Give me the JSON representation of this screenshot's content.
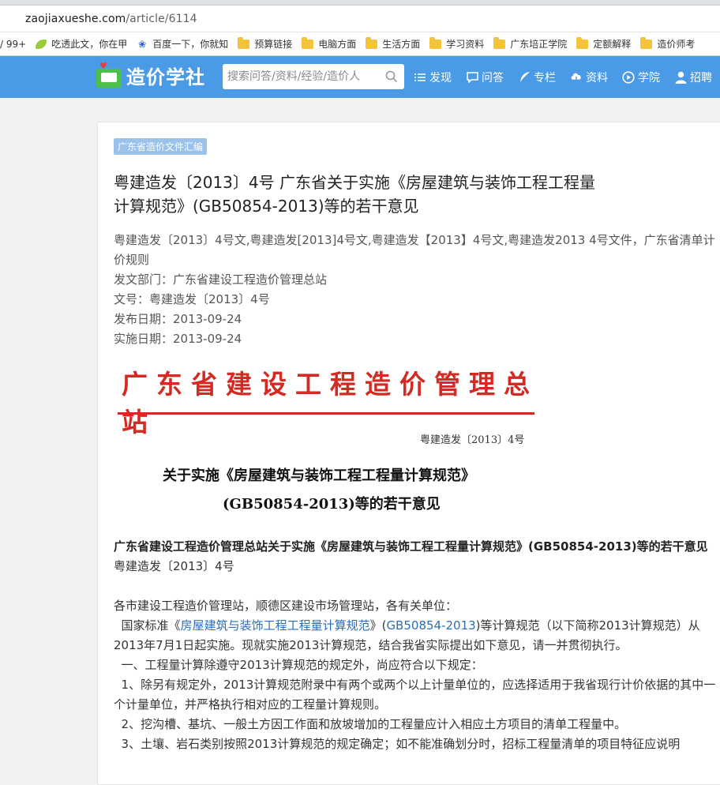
{
  "browser": {
    "url_domain": "zaojiaxueshe.com",
    "url_path": "/article/6114",
    "bookmarks": [
      {
        "label": "/ 99+",
        "icon": "none"
      },
      {
        "label": "吃透此文，你在甲",
        "icon": "leaf-icon"
      },
      {
        "label": "百度一下，你就知",
        "icon": "baidu-paw-icon"
      },
      {
        "label": "预算链接",
        "icon": "folder-icon"
      },
      {
        "label": "电脑方面",
        "icon": "folder-icon"
      },
      {
        "label": "生活方面",
        "icon": "folder-icon"
      },
      {
        "label": "学习资料",
        "icon": "folder-icon"
      },
      {
        "label": "广东培正学院",
        "icon": "folder-icon"
      },
      {
        "label": "定额解释",
        "icon": "folder-icon"
      },
      {
        "label": "造价师考",
        "icon": "folder-icon"
      }
    ]
  },
  "header": {
    "logo_text": "造价学社",
    "search_placeholder": "搜索问答/资料/经验/造价人",
    "nav": [
      {
        "label": "发现",
        "icon": "list-icon"
      },
      {
        "label": "问答",
        "icon": "chat-icon"
      },
      {
        "label": "专栏",
        "icon": "feather-icon"
      },
      {
        "label": "资料",
        "icon": "cloud-download-icon"
      },
      {
        "label": "学院",
        "icon": "play-circle-icon"
      },
      {
        "label": "招聘",
        "icon": "person-icon"
      }
    ],
    "colors": {
      "bar": "#4a9ae6",
      "logo_green": "#4cc04a"
    }
  },
  "article": {
    "category": "广东省造价文件汇编",
    "title": "粤建造发〔2013〕4号 广东省关于实施《房屋建筑与装饰工程工程量计算规范》(GB50854-2013)等的若干意见",
    "meta": {
      "keywords": "粤建造发〔2013〕4号文,粤建造发[2013]4号文,粤建造发【2013】4号文,粤建造发2013 4号文件，广东省清单计价规则",
      "department": "发文部门：广东省建设工程造价管理总站",
      "doc_no": "文号：粤建造发〔2013〕4号",
      "publish_date": "发布日期：2013-09-24",
      "effective_date": "实施日期：2013-09-24"
    },
    "letterhead": {
      "org": "广东省建设工程造价管理总站",
      "doc_no": "粤建造发〔2013〕4号",
      "title_line1": "关于实施《房屋建筑与装饰工程工程量计算规范》",
      "title_line2": "(GB50854-2013)等的若干意见"
    },
    "body": {
      "bold_heading": "广东省建设工程造价管理总站关于实施《房屋建筑与装饰工程工程量计算规范》(GB50854-2013)等的若干意见",
      "doc_no_line": "粤建造发〔2013〕4号",
      "salutation": "各市建设工程造价管理站，顺德区建设市场管理站，各有关单位：",
      "p1_prefix": "国家标准《",
      "p1_link": "房屋建筑与装饰工程工程量计算规范",
      "p1_mid": "》(",
      "p1_link2": "GB50854-2013",
      "p1_suffix": ")等计算规范（以下简称2013计算规范）从2013年7月1日起实施。现就实施2013计算规范，结合我省实际提出如下意见，请一并贯彻执行。",
      "item_heading": "一、工程量计算除遵守2013计算规范的规定外，尚应符合以下规定：",
      "item1": "1、除另有规定外，2013计算规范附录中有两个或两个以上计量单位的，应选择适用于我省现行计价依据的其中一个计量单位，并严格执行相对应的工程量计算规则。",
      "item2": "2、挖沟槽、基坑、一般土方因工作面和放坡增加的工程量应计入相应土方项目的清单工程量中。",
      "item3": "3、土壤、岩石类别按照2013计算规范的规定确定；如不能准确划分时，招标工程量清单的项目特征应说明"
    }
  }
}
